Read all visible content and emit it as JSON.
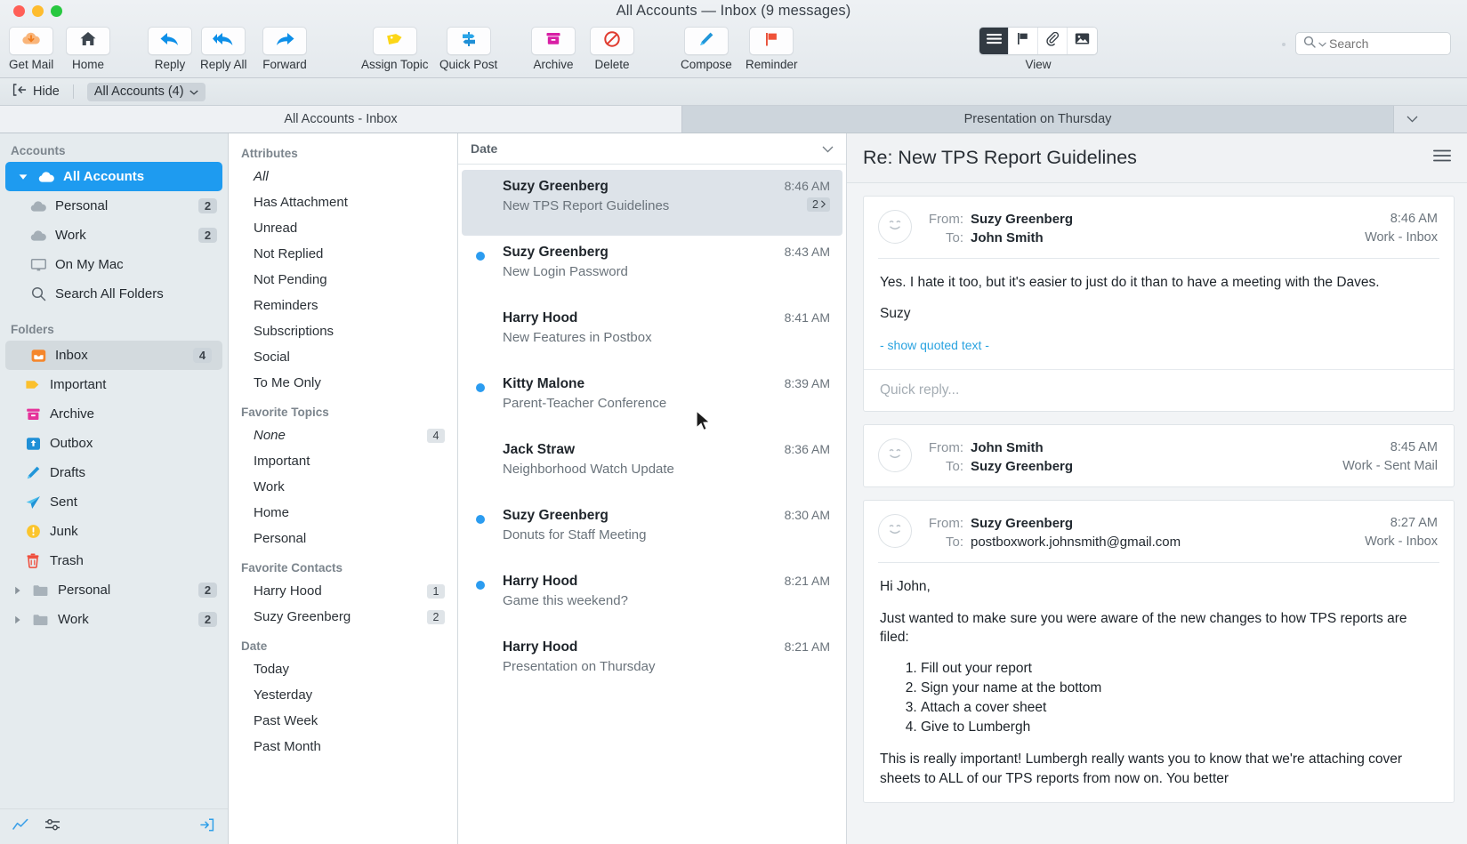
{
  "window": {
    "title": "All Accounts — Inbox (9 messages)"
  },
  "toolbar": {
    "items": [
      {
        "label": "Get Mail",
        "icon": "cloud-download-icon"
      },
      {
        "label": "Home",
        "icon": "home-icon"
      },
      {
        "label": "Reply",
        "icon": "reply-arrow-icon"
      },
      {
        "label": "Reply All",
        "icon": "reply-all-arrow-icon"
      },
      {
        "label": "Forward",
        "icon": "forward-arrow-icon"
      },
      {
        "label": "Assign Topic",
        "icon": "tag-icon"
      },
      {
        "label": "Quick Post",
        "icon": "signpost-icon"
      },
      {
        "label": "Archive",
        "icon": "archive-box-icon"
      },
      {
        "label": "Delete",
        "icon": "no-entry-icon"
      },
      {
        "label": "Compose",
        "icon": "pencil-icon"
      },
      {
        "label": "Reminder",
        "icon": "flag-icon"
      }
    ],
    "view": {
      "label": "View",
      "segments": [
        {
          "icon": "list-lines-icon",
          "active": true
        },
        {
          "icon": "flag-outline-icon",
          "active": false
        },
        {
          "icon": "paperclip-icon",
          "active": false
        },
        {
          "icon": "image-icon",
          "active": false
        }
      ]
    },
    "search": {
      "placeholder": "Search",
      "value": "",
      "icon": "search-icon"
    }
  },
  "subbar": {
    "hide_label": "Hide",
    "hide_icon": "hide-panel-icon",
    "account_popup_label": "All Accounts (4)",
    "account_popup_icon": "chevron-down-icon"
  },
  "tabs": [
    {
      "label": "All Accounts - Inbox",
      "active": false
    },
    {
      "label": "Presentation on Thursday",
      "active": true
    }
  ],
  "tabbar": {
    "overflow_icon": "chevron-down-icon"
  },
  "sidebar": {
    "accounts_header": "Accounts",
    "accounts": [
      {
        "label": "All Accounts",
        "icon": "cloud-icon",
        "count": "",
        "selected": true,
        "disclosure": "down",
        "indent": 0
      },
      {
        "label": "Personal",
        "icon": "cloud-grey-icon",
        "count": "2",
        "selected": false,
        "disclosure": "",
        "indent": 1
      },
      {
        "label": "Work",
        "icon": "cloud-grey-icon",
        "count": "2",
        "selected": false,
        "disclosure": "",
        "indent": 1
      },
      {
        "label": "On My Mac",
        "icon": "monitor-icon",
        "count": "",
        "selected": false,
        "disclosure": "",
        "indent": 1
      },
      {
        "label": "Search All Folders",
        "icon": "search-icon",
        "count": "",
        "selected": false,
        "disclosure": "",
        "indent": 1
      }
    ],
    "folders_header": "Folders",
    "folders": [
      {
        "label": "Inbox",
        "icon": "inbox-icon",
        "count": "4",
        "selected": true,
        "disclosure": "",
        "indent": 1
      },
      {
        "label": "Important",
        "icon": "tag-yellow-icon",
        "count": "",
        "selected": false,
        "disclosure": "",
        "indent": 1
      },
      {
        "label": "Archive",
        "icon": "archive-box-icon",
        "count": "",
        "selected": false,
        "disclosure": "",
        "indent": 1
      },
      {
        "label": "Outbox",
        "icon": "outbox-icon",
        "count": "",
        "selected": false,
        "disclosure": "",
        "indent": 1
      },
      {
        "label": "Drafts",
        "icon": "pencil-icon",
        "count": "",
        "selected": false,
        "disclosure": "",
        "indent": 1
      },
      {
        "label": "Sent",
        "icon": "paper-plane-icon",
        "count": "",
        "selected": false,
        "disclosure": "",
        "indent": 1
      },
      {
        "label": "Junk",
        "icon": "warning-circle-icon",
        "count": "",
        "selected": false,
        "disclosure": "",
        "indent": 1
      },
      {
        "label": "Trash",
        "icon": "trash-icon",
        "count": "",
        "selected": false,
        "disclosure": "",
        "indent": 1
      },
      {
        "label": "Personal",
        "icon": "folder-icon",
        "count": "2",
        "selected": false,
        "disclosure": "right",
        "indent": 0
      },
      {
        "label": "Work",
        "icon": "folder-icon",
        "count": "2",
        "selected": false,
        "disclosure": "right",
        "indent": 0
      }
    ],
    "footer": {
      "stats_icon": "activity-icon",
      "settings_icon": "sliders-icon",
      "logout_icon": "sign-out-icon"
    }
  },
  "attributes": {
    "groups": [
      {
        "header": "Attributes",
        "items": [
          {
            "label": "All",
            "badge": "",
            "italic": true
          },
          {
            "label": "Has Attachment",
            "badge": "",
            "italic": false
          },
          {
            "label": "Unread",
            "badge": "",
            "italic": false
          },
          {
            "label": "Not Replied",
            "badge": "",
            "italic": false
          },
          {
            "label": "Not Pending",
            "badge": "",
            "italic": false
          },
          {
            "label": "Reminders",
            "badge": "",
            "italic": false
          },
          {
            "label": "Subscriptions",
            "badge": "",
            "italic": false
          },
          {
            "label": "Social",
            "badge": "",
            "italic": false
          },
          {
            "label": "To Me Only",
            "badge": "",
            "italic": false
          }
        ]
      },
      {
        "header": "Favorite Topics",
        "items": [
          {
            "label": "None",
            "badge": "4",
            "italic": true
          },
          {
            "label": "Important",
            "badge": "",
            "italic": false
          },
          {
            "label": "Work",
            "badge": "",
            "italic": false
          },
          {
            "label": "Home",
            "badge": "",
            "italic": false
          },
          {
            "label": "Personal",
            "badge": "",
            "italic": false
          }
        ]
      },
      {
        "header": "Favorite Contacts",
        "items": [
          {
            "label": "Harry Hood",
            "badge": "1",
            "italic": false
          },
          {
            "label": "Suzy Greenberg",
            "badge": "2",
            "italic": false
          }
        ]
      },
      {
        "header": "Date",
        "items": [
          {
            "label": "Today",
            "badge": "",
            "italic": false
          },
          {
            "label": "Yesterday",
            "badge": "",
            "italic": false
          },
          {
            "label": "Past Week",
            "badge": "",
            "italic": false
          },
          {
            "label": "Past Month",
            "badge": "",
            "italic": false
          }
        ]
      }
    ]
  },
  "message_list": {
    "sort_header": "Date",
    "sort_chevron_icon": "chevron-down-icon",
    "rows": [
      {
        "sender": "Suzy Greenberg",
        "subject": "New TPS Report Guidelines",
        "time": "8:46 AM",
        "unread": false,
        "selected": true,
        "thread_count": "2"
      },
      {
        "sender": "Suzy Greenberg",
        "subject": "New Login Password",
        "time": "8:43 AM",
        "unread": true,
        "selected": false,
        "thread_count": ""
      },
      {
        "sender": "Harry Hood",
        "subject": "New Features in Postbox",
        "time": "8:41 AM",
        "unread": false,
        "selected": false,
        "thread_count": ""
      },
      {
        "sender": "Kitty Malone",
        "subject": "Parent-Teacher Conference",
        "time": "8:39 AM",
        "unread": true,
        "selected": false,
        "thread_count": ""
      },
      {
        "sender": "Jack Straw",
        "subject": "Neighborhood Watch Update",
        "time": "8:36 AM",
        "unread": false,
        "selected": false,
        "thread_count": ""
      },
      {
        "sender": "Suzy Greenberg",
        "subject": "Donuts for Staff Meeting",
        "time": "8:30 AM",
        "unread": true,
        "selected": false,
        "thread_count": ""
      },
      {
        "sender": "Harry Hood",
        "subject": "Game this weekend?",
        "time": "8:21 AM",
        "unread": true,
        "selected": false,
        "thread_count": ""
      },
      {
        "sender": "Harry Hood",
        "subject": "Presentation on Thursday",
        "time": "8:21 AM",
        "unread": false,
        "selected": false,
        "thread_count": ""
      }
    ]
  },
  "reader": {
    "title": "Re: New TPS Report Guidelines",
    "menu_icon": "hamburger-menu-icon",
    "from_label": "From:",
    "to_label": "To:",
    "quick_reply_placeholder": "Quick reply...",
    "messages": [
      {
        "from": "Suzy Greenberg",
        "to": "John Smith",
        "time": "8:46 AM",
        "folder": "Work - Inbox",
        "avatar_icon": "smiley-avatar-icon",
        "paragraphs": [
          "Yes. I hate it too, but it's easier to just do it than to have a meeting with the Daves.",
          "Suzy"
        ],
        "quoted_link": "- show quoted text -",
        "has_quick_reply": true,
        "list_items": []
      },
      {
        "from": "John Smith",
        "to": "Suzy Greenberg",
        "time": "8:45 AM",
        "folder": "Work - Sent Mail",
        "avatar_icon": "smiley-avatar-icon",
        "paragraphs": [],
        "quoted_link": "",
        "has_quick_reply": false,
        "list_items": []
      },
      {
        "from": "Suzy Greenberg",
        "to": "postboxwork.johnsmith@gmail.com",
        "time": "8:27 AM",
        "folder": "Work - Inbox",
        "avatar_icon": "smiley-avatar-icon",
        "paragraphs": [
          "Hi John,",
          "Just wanted to make sure you were aware of the new changes to how TPS reports are filed:"
        ],
        "list_items": [
          "Fill out your report",
          "Sign your name at the bottom",
          "Attach a cover sheet",
          "Give to Lumbergh"
        ],
        "trailing_paragraph": "This is really important! Lumbergh really wants you to know that we're attaching cover sheets to ALL of our TPS reports from now on. You better",
        "quoted_link": "",
        "has_quick_reply": false
      }
    ]
  },
  "colors": {
    "accent_blue": "#1e9bf0",
    "unread_dot": "#2b9cf0",
    "orange": "#f5862b",
    "magenta": "#e5329a",
    "yellow": "#fbc02d",
    "red": "#ef4a38"
  }
}
